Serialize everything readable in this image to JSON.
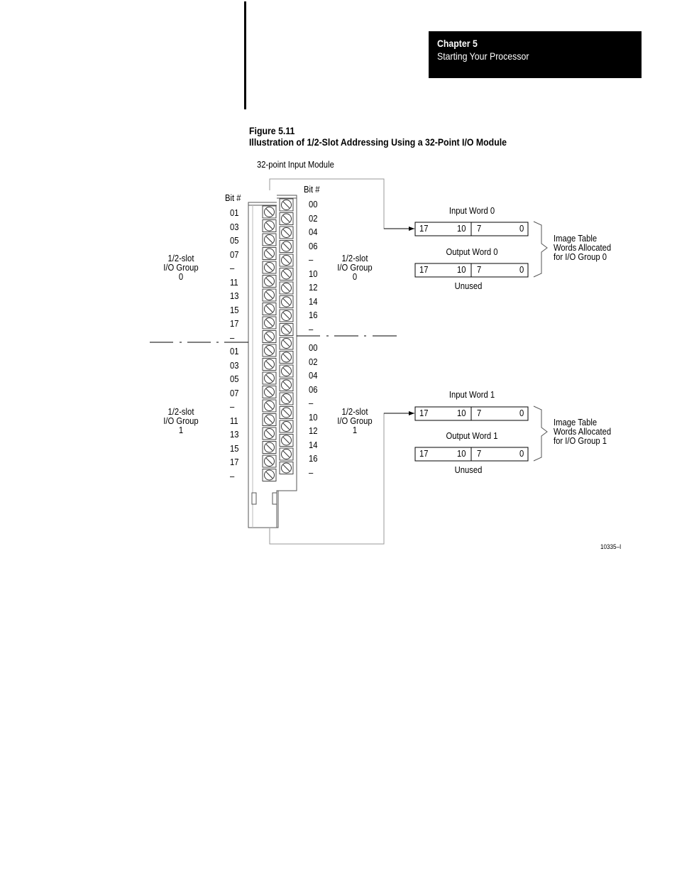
{
  "header": {
    "chapter": "Chapter 5",
    "chapter_title": "Starting Your Processor"
  },
  "figure": {
    "number": "Figure 5.11",
    "title": "Illustration of 1/2-Slot Addressing Using a 32-Point I/O Module",
    "module_label": "32-point Input Module",
    "figure_id": "10335–I"
  },
  "left_column": {
    "header": "Bit #",
    "bits": [
      "01",
      "03",
      "05",
      "07",
      "–",
      "11",
      "13",
      "15",
      "17",
      "–",
      "01",
      "03",
      "05",
      "07",
      "–",
      "11",
      "13",
      "15",
      "17",
      "–"
    ]
  },
  "right_column": {
    "header": "Bit #",
    "bits": [
      "00",
      "02",
      "04",
      "06",
      "–",
      "10",
      "12",
      "14",
      "16",
      "–",
      "00",
      "02",
      "04",
      "06",
      "–",
      "10",
      "12",
      "14",
      "16",
      "–"
    ]
  },
  "groups": [
    {
      "left_label": [
        "1/2-slot",
        "I/O Group",
        "0"
      ],
      "right_label": [
        "1/2-slot",
        "I/O Group",
        "0"
      ],
      "input_word": {
        "title": "Input Word 0",
        "bits": [
          "17",
          "10",
          "7",
          "0"
        ]
      },
      "output_word": {
        "title": "Output Word 0",
        "bits": [
          "17",
          "10",
          "7",
          "0"
        ],
        "note": "Unused"
      },
      "brace_label": [
        "Image Table",
        "Words Allocated",
        "for I/O Group 0"
      ]
    },
    {
      "left_label": [
        "1/2-slot",
        "I/O Group",
        "1"
      ],
      "right_label": [
        "1/2-slot",
        "I/O Group",
        "1"
      ],
      "input_word": {
        "title": "Input Word 1",
        "bits": [
          "17",
          "10",
          "7",
          "0"
        ]
      },
      "output_word": {
        "title": "Output Word 1",
        "bits": [
          "17",
          "10",
          "7",
          "0"
        ],
        "note": "Unused"
      },
      "brace_label": [
        "Image Table",
        "Words Allocated",
        "for I/O Group 1"
      ]
    }
  ]
}
